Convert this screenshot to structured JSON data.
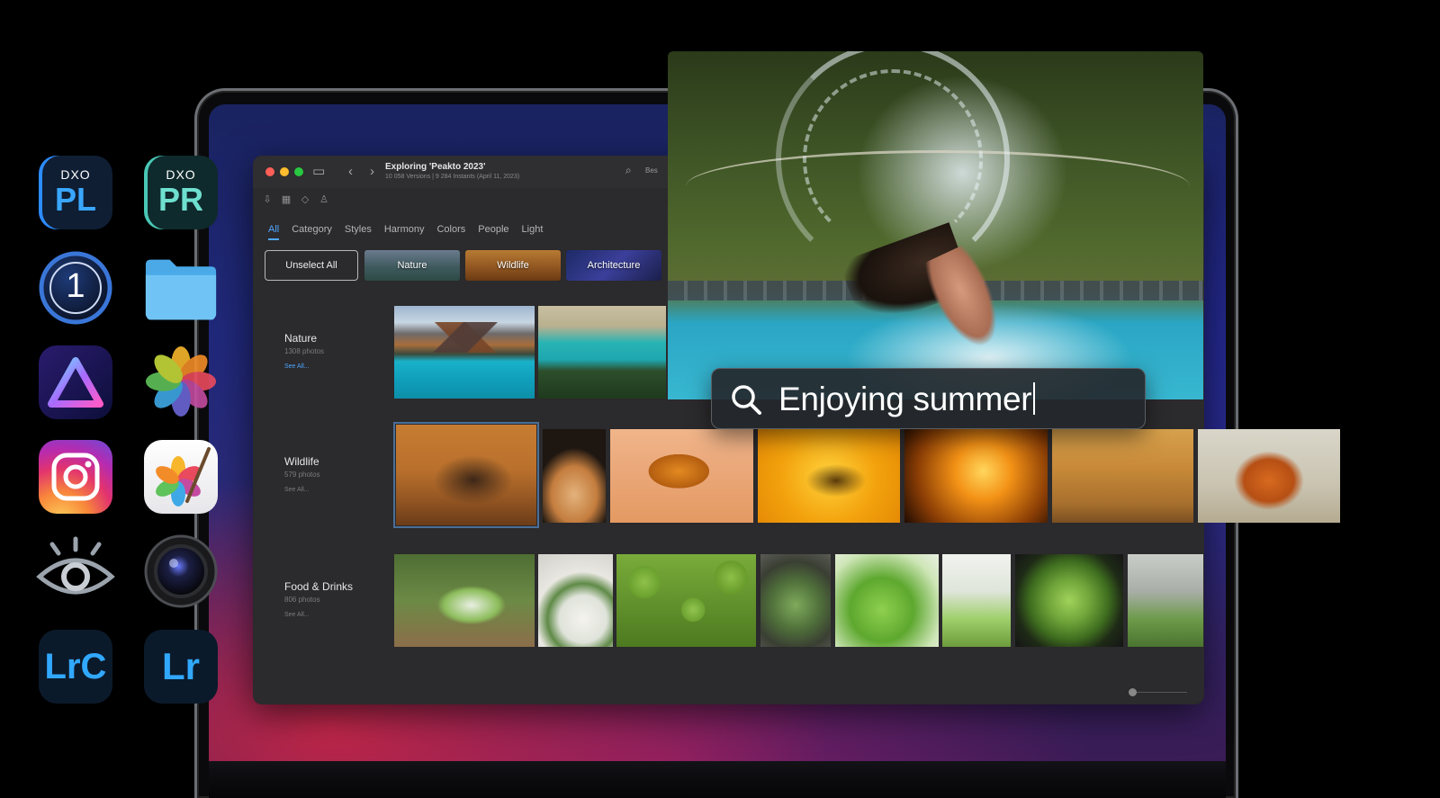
{
  "window": {
    "title": "Exploring 'Peakto 2023'",
    "subtitle": "10 058 Versions | 9 284 Instants (April 11, 2023)",
    "search_hint": "Bes"
  },
  "tabs": [
    {
      "label": "All",
      "active": true
    },
    {
      "label": "Category"
    },
    {
      "label": "Styles"
    },
    {
      "label": "Harmony"
    },
    {
      "label": "Colors"
    },
    {
      "label": "People"
    },
    {
      "label": "Light"
    }
  ],
  "filters": {
    "unselect_label": "Unselect All",
    "chips": [
      "Nature",
      "Wildlife",
      "Architecture"
    ]
  },
  "sections": [
    {
      "title": "Nature",
      "count": "1308 photos",
      "see_all": "See All..."
    },
    {
      "title": "Wildlife",
      "count": "579 photos",
      "see_all": "See All..."
    },
    {
      "title": "Food & Drinks",
      "count": "806 photos",
      "see_all": "See All..."
    }
  ],
  "search_overlay": {
    "query": "Enjoying summer"
  },
  "dock_apps": [
    {
      "name": "DxO PhotoLab",
      "mark": "DXO",
      "letters": "PL",
      "accent": "#3aa7ff"
    },
    {
      "name": "DxO PureRaw",
      "mark": "DXO",
      "letters": "PR",
      "accent": "#6fe0cf"
    },
    {
      "name": "Capture One",
      "letters": "1"
    },
    {
      "name": "Folder"
    },
    {
      "name": "Luminar"
    },
    {
      "name": "Photos"
    },
    {
      "name": "Instagram"
    },
    {
      "name": "Pixelmator"
    },
    {
      "name": "Eye app"
    },
    {
      "name": "Camera lens app"
    },
    {
      "name": "Lightroom Classic",
      "letters": "LrC",
      "accent": "#31a8ff"
    },
    {
      "name": "Lightroom",
      "letters": "Lr",
      "accent": "#31a8ff"
    }
  ],
  "colors": {
    "accent_blue": "#4ea6ff",
    "window_bg": "#2b2a2c"
  }
}
